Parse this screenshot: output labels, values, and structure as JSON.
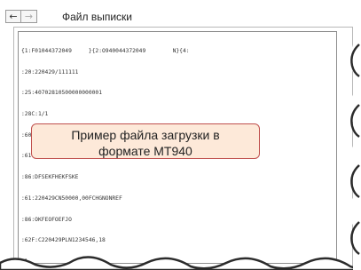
{
  "window": {
    "title": "Файл выписки",
    "back_icon": "arrow-left-icon",
    "forward_icon": "arrow-right-icon",
    "back_glyph": "←",
    "forward_glyph": "→"
  },
  "file_lines": [
    "{1:F01044372049     }{2:O940044372049        N}{4:",
    ":20:220429/111111",
    ":25:40702810500000000001",
    ":28C:1/1",
    ":60F:C220429PLN100,00",
    ":61:220429CN50,00NTRFNONREF",
    ":86:DFSEKFHEKFSKE",
    ":61:220429CN50000,00FCHGNONREF",
    ":86:OKFEOFOEFJO",
    ":62F:C220429PLN1234546,18",
    "-}"
  ],
  "callout": {
    "line1": "Пример файла загрузки в",
    "line2": "формате MT940"
  },
  "colors": {
    "callout_fill": "#fde9d9",
    "callout_border": "#c0504d"
  }
}
